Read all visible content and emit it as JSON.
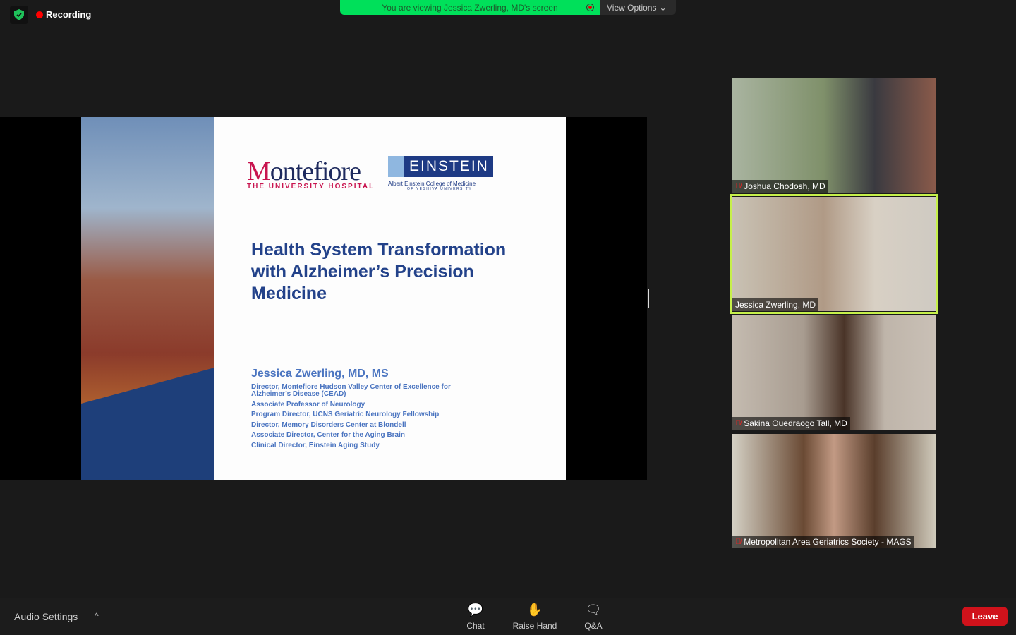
{
  "topbar": {
    "recording": "Recording",
    "banner": "You are viewing Jessica Zwerling, MD's screen",
    "view_options": "View Options"
  },
  "slide": {
    "logo_montefiore": "Montefiore",
    "logo_montefiore_sub": "THE UNIVERSITY HOSPITAL",
    "logo_einstein": "EINSTEIN",
    "logo_einstein_sub": "Albert Einstein College of Medicine",
    "logo_einstein_sub2": "OF YESHIVA UNIVERSITY",
    "title": "Health System Transformation with Alzheimer’s Precision Medicine",
    "author": "Jessica Zwerling, MD, MS",
    "roles": [
      "Director, Montefiore Hudson Valley Center of Excellence for Alzheimer’s Disease (CEAD)",
      "Associate Professor of Neurology",
      "Program Director, UCNS Geriatric Neurology Fellowship",
      "Director, Memory Disorders Center at Blondell",
      "Associate Director, Center for the Aging Brain",
      "Clinical Director, Einstein Aging Study"
    ]
  },
  "participants": [
    {
      "name": "Joshua Chodosh, MD",
      "muted": true,
      "bg": "#7b8a6e"
    },
    {
      "name": "Jessica Zwerling, MD",
      "muted": false,
      "bg": "#b9b0a2",
      "active": true
    },
    {
      "name": "Sakina Ouedraogo Tall, MD",
      "muted": true,
      "bg": "#b8aca0"
    },
    {
      "name": "Metropolitan Area Geriatrics Society - MAGS",
      "muted": true,
      "bg": "#8a7a68"
    }
  ],
  "bottombar": {
    "audio_settings": "Audio Settings",
    "chat": "Chat",
    "raise_hand": "Raise Hand",
    "qa": "Q&A",
    "leave": "Leave"
  }
}
